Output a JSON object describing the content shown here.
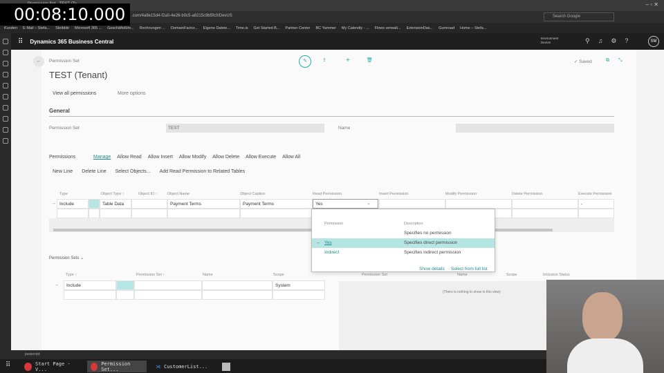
{
  "timer": "00:08:10.000",
  "browser": {
    "tab_title": "Permission Set - TEST (Te...",
    "url": ".com/4a8e15d4-f2a0-4e26-b0c5-a8215c9b5fc0/DevUS",
    "search_placeholder": "Search Google",
    "bookmarks": [
      "Kunden",
      "E-Mail – Stefa...",
      "Skribble",
      "Microsoft 365 ...",
      "Geschäftsführ...",
      "Rechnungen ...",
      "DomainFactor...",
      "Eigene Dateie...",
      "Time.is",
      "Get Started B...",
      "Partner Center",
      "BC Yammer",
      "My Calendly - ...",
      "Flows verwalt...",
      "ExtensionDas...",
      "Gumroad",
      "Home – Stefa..."
    ]
  },
  "app": {
    "name": "Dynamics 365 Business Central",
    "environment_label": "Environment",
    "environment": "DevUS",
    "user_initials": "SM"
  },
  "page": {
    "caption": "Permission Set",
    "title": "TEST (Tenant)",
    "saved": "Saved",
    "actions": {
      "view_all": "View all permissions",
      "more": "More options"
    },
    "general": {
      "heading": "General",
      "permission_set_label": "Permission Set",
      "permission_set_value": "TEST",
      "name_label": "Name",
      "name_value": ""
    },
    "permissions": {
      "heading": "Permissions",
      "tabs": [
        "Manage",
        "Allow Read",
        "Allow Insert",
        "Allow Modify",
        "Allow Delete",
        "Allow Execute",
        "Allow All"
      ],
      "actions": [
        "New Line",
        "Delete Line",
        "Select Objects...",
        "Add Read Permission to Related Tables"
      ],
      "columns": [
        "Type",
        "Object Type ↑",
        "Object ID ↑",
        "Object Name",
        "Object Caption",
        "Read Permission",
        "Insert Permission",
        "Modify Permission",
        "Delete Permission",
        "Execute Permission"
      ],
      "row": {
        "type": "Include",
        "object_type": "Table Data",
        "object_id": "",
        "object_name": "Payment Terms",
        "object_caption": "Payment Terms",
        "read": "Yes",
        "execute": "-"
      }
    },
    "dropdown": {
      "columns": [
        "Permission",
        "Description"
      ],
      "options": [
        {
          "permission": "",
          "description": "Specifies no permission"
        },
        {
          "permission": "Yes",
          "description": "Specifies direct permission",
          "selected": true
        },
        {
          "permission": "Indirect",
          "description": "Specifies indirect permission"
        }
      ],
      "show_details": "Show details",
      "select_full": "Select from full list"
    },
    "permission_sets": {
      "heading": "Permission Sets",
      "columns": [
        "Type ↑",
        "Permission Set ↑",
        "Name",
        "Scope"
      ],
      "row": {
        "type": "Include",
        "permission_set": "",
        "name": "",
        "scope": "System"
      },
      "right_columns": [
        "Permission Set",
        "Name",
        "Scope",
        "Inclusion Status"
      ],
      "empty": "(There is nothing to show in this view)"
    }
  },
  "status_text": "javascript:",
  "taskbar": [
    "Start Page - V...",
    "Permission Set...",
    "CustomerList..."
  ],
  "colors": {
    "accent": "#00a3a3",
    "selected_row": "#b5e6e4",
    "link": "#1a8c8c"
  }
}
